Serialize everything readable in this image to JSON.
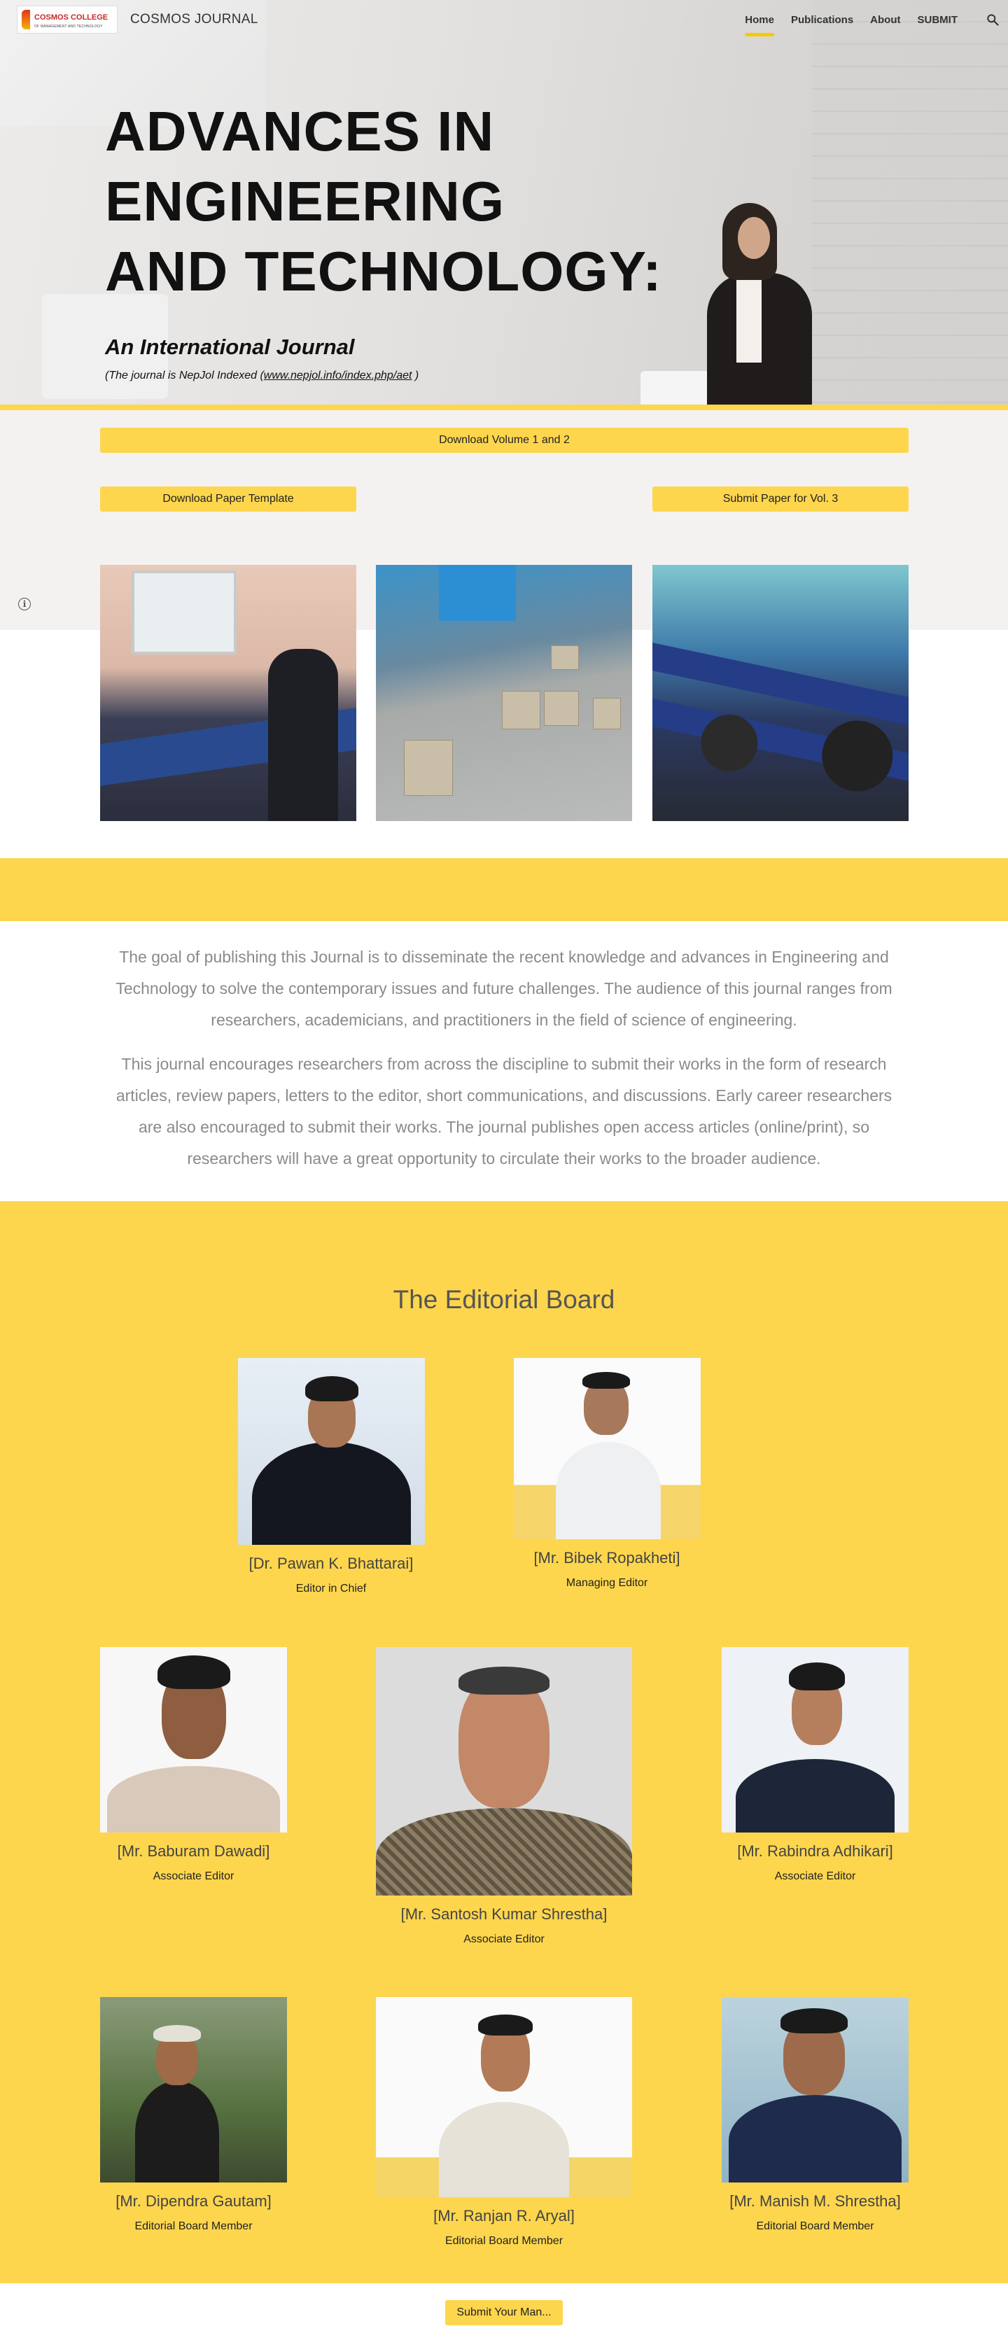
{
  "nav": {
    "logo_text": "COSMOS COLLEGE",
    "logo_sub": "OF MANAGEMENT AND TECHNOLOGY",
    "site_title": "COSMOS JOURNAL",
    "links": [
      "Home",
      "Publications",
      "About",
      "SUBMIT"
    ],
    "active": "Home"
  },
  "hero": {
    "title_line1": "ADVANCES IN ENGINEERING",
    "title_line2": "AND TECHNOLOGY:",
    "subtitle": "An International Journal",
    "note_prefix": "(The journal is NepJol Indexed (",
    "note_link": "www.nepjol.info/index.php/aet",
    "note_suffix": " )"
  },
  "downloads": {
    "volume_btn": "Download Volume 1 and 2",
    "template_btn": "Download Paper Template",
    "submit_btn": "Submit Paper for Vol. 3"
  },
  "about": {
    "p1": "The goal of publishing this Journal is to disseminate the recent knowledge and advances in Engineering and Technology to solve the contemporary issues and future challenges. The audience of this journal ranges from researchers, academicians, and practitioners in the field of science of engineering.",
    "p2": "This journal encourages researchers from across the discipline to submit their works in the form of research articles, review papers, letters to the editor, short communications, and discussions. Early career researchers are also encouraged to submit their works. The journal publishes open access articles (online/print), so researchers will have a great opportunity to circulate their works to the broader audience."
  },
  "editorial": {
    "title": "The Editorial Board",
    "members": [
      {
        "name": "[Dr. Pawan K. Bhattarai]",
        "role": "Editor in Chief"
      },
      {
        "name": "[Mr. Bibek Ropakheti]",
        "role": "Managing Editor"
      },
      {
        "name": "[Mr. Baburam Dawadi]",
        "role": "Associate Editor"
      },
      {
        "name": "[Mr. Santosh Kumar Shrestha]",
        "role": "Associate Editor"
      },
      {
        "name": "[Mr. Rabindra Adhikari]",
        "role": "Associate Editor"
      },
      {
        "name": "[Mr. Dipendra Gautam]",
        "role": "Editorial Board Member"
      },
      {
        "name": "[Mr. Ranjan R. Aryal]",
        "role": "Editorial Board Member"
      },
      {
        "name": "[Mr. Manish M. Shrestha]",
        "role": "Editorial Board Member"
      }
    ]
  },
  "footer": {
    "button": "Submit Your Man..."
  },
  "colors": {
    "accent": "#fdd64d",
    "section_bg": "#f4f2f0"
  }
}
